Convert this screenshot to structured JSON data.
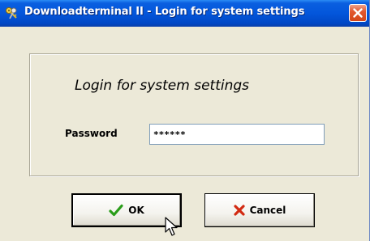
{
  "window": {
    "title": "Downloadterminal II - Login for system settings",
    "title_icon": "keys-icon",
    "close_icon": "close-icon"
  },
  "form": {
    "heading": "Login for system settings",
    "password_label": "Password",
    "password_value": "******"
  },
  "buttons": {
    "ok_label": "OK",
    "ok_icon": "checkmark-icon",
    "cancel_label": "Cancel",
    "cancel_icon": "x-icon"
  },
  "colors": {
    "titlebar": "#0356db",
    "dialog_bg": "#ece9d8",
    "ok_icon": "#2a9d1a",
    "cancel_icon": "#d22a12"
  }
}
